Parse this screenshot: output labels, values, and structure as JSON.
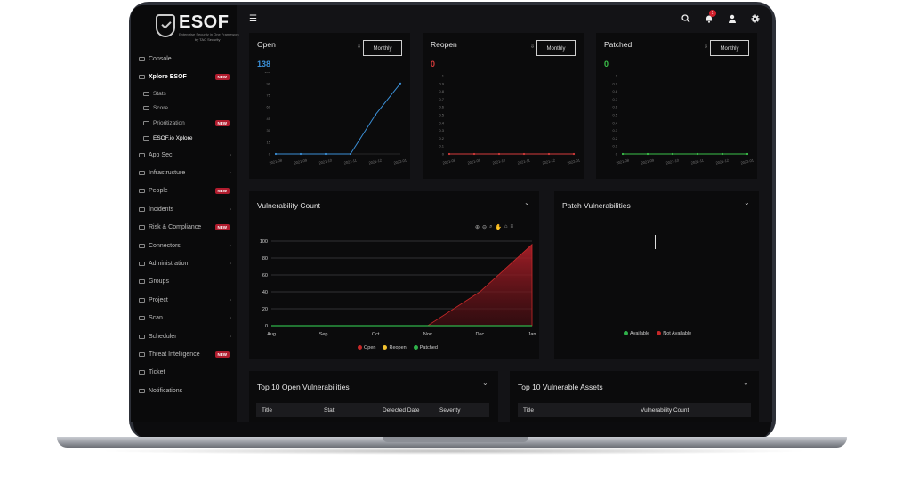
{
  "app": {
    "brand": "ESOF",
    "subtitle": "Enterprise Security in One Framework",
    "by": "by TAC Security",
    "notification_count": "1"
  },
  "icons": {
    "menu": "hamburger-icon",
    "search": "search-icon",
    "notifications": "bell-icon",
    "user": "user-icon",
    "settings": "gear-icon"
  },
  "sidebar": {
    "items": [
      {
        "label": "Console",
        "icon": "console-icon",
        "sub": false,
        "active": false,
        "chevron": false,
        "new": false
      },
      {
        "label": "Xplore ESOF",
        "icon": "explore-icon",
        "sub": false,
        "active": true,
        "chevron": false,
        "new": true
      },
      {
        "label": "Stats",
        "icon": "stats-icon",
        "sub": true,
        "active": false,
        "chevron": false,
        "new": false
      },
      {
        "label": "Score",
        "icon": "score-icon",
        "sub": true,
        "active": false,
        "chevron": false,
        "new": false
      },
      {
        "label": "Prioritization",
        "icon": "prioritization-icon",
        "sub": true,
        "active": false,
        "chevron": false,
        "new": true
      },
      {
        "label": "ESOF.io Xplore",
        "icon": "xplore-icon",
        "sub": true,
        "active": true,
        "chevron": false,
        "new": false
      },
      {
        "label": "App Sec",
        "icon": "appsec-icon",
        "sub": false,
        "active": false,
        "chevron": true,
        "new": false
      },
      {
        "label": "Infrastructure",
        "icon": "infrastructure-icon",
        "sub": false,
        "active": false,
        "chevron": true,
        "new": false
      },
      {
        "label": "People",
        "icon": "people-icon",
        "sub": false,
        "active": false,
        "chevron": false,
        "new": true
      },
      {
        "label": "Incidents",
        "icon": "incidents-icon",
        "sub": false,
        "active": false,
        "chevron": true,
        "new": false
      },
      {
        "label": "Risk & Compliance",
        "icon": "risk-icon",
        "sub": false,
        "active": false,
        "chevron": false,
        "new": true
      },
      {
        "label": "Connectors",
        "icon": "connectors-icon",
        "sub": false,
        "active": false,
        "chevron": true,
        "new": false
      },
      {
        "label": "Administration",
        "icon": "administration-icon",
        "sub": false,
        "active": false,
        "chevron": true,
        "new": false
      },
      {
        "label": "Groups",
        "icon": "groups-icon",
        "sub": false,
        "active": false,
        "chevron": false,
        "new": false
      },
      {
        "label": "Project",
        "icon": "project-icon",
        "sub": false,
        "active": false,
        "chevron": true,
        "new": false
      },
      {
        "label": "Scan",
        "icon": "scan-icon",
        "sub": false,
        "active": false,
        "chevron": true,
        "new": false
      },
      {
        "label": "Scheduler",
        "icon": "scheduler-icon",
        "sub": false,
        "active": false,
        "chevron": true,
        "new": false
      },
      {
        "label": "Threat Intelligence",
        "icon": "threat-icon",
        "sub": false,
        "active": false,
        "chevron": false,
        "new": true
      },
      {
        "label": "Ticket",
        "icon": "ticket-icon",
        "sub": false,
        "active": false,
        "chevron": false,
        "new": false
      },
      {
        "label": "Notifications",
        "icon": "notifications-icon",
        "sub": false,
        "active": false,
        "chevron": false,
        "new": false
      }
    ],
    "new_badge": "NEW"
  },
  "cards": {
    "open": {
      "title": "Open",
      "value": "138",
      "color": "#3b8fd6",
      "button": "Monthly"
    },
    "reopen": {
      "title": "Reopen",
      "value": "0",
      "color": "#d63b3b",
      "button": "Monthly"
    },
    "patched": {
      "title": "Patched",
      "value": "0",
      "color": "#3bc24a",
      "button": "Monthly"
    },
    "vuln_count": {
      "title": "Vulnerability Count"
    },
    "patch_vuln": {
      "title": "Patch Vulnerabilities",
      "legend": [
        "Available",
        "Not Available"
      ],
      "legend_colors": [
        "#2fb24a",
        "#c62828"
      ]
    },
    "top_open": {
      "title": "Top 10 Open Vulnerabilities",
      "columns": [
        "Title",
        "Stat",
        "Detected Date",
        "Severity"
      ]
    },
    "top_assets": {
      "title": "Top 10 Vulnerable Assets",
      "columns": [
        "Title",
        "Vulnerability Count"
      ]
    }
  },
  "chart_data": [
    {
      "type": "line",
      "id": "open",
      "title": "Open",
      "x": [
        "2021-08",
        "2021-09",
        "2021-10",
        "2021-11",
        "2021-12",
        "2022-01"
      ],
      "values": [
        0,
        0,
        0,
        0,
        50,
        90
      ],
      "ylim": [
        0,
        100
      ],
      "yticks": [
        0,
        15,
        30,
        45,
        60,
        75,
        90,
        105
      ]
    },
    {
      "type": "line",
      "id": "reopen",
      "title": "Reopen",
      "x": [
        "2021-08",
        "2021-09",
        "2021-10",
        "2021-11",
        "2021-12",
        "2022-01"
      ],
      "values": [
        0,
        0,
        0,
        0,
        0,
        0
      ],
      "ylim": [
        0,
        1
      ],
      "yticks": [
        0,
        0.1,
        0.2,
        0.3,
        0.4,
        0.5,
        0.6,
        0.7,
        0.8,
        0.9,
        1.0
      ]
    },
    {
      "type": "line",
      "id": "patched",
      "title": "Patched",
      "x": [
        "2021-08",
        "2021-09",
        "2021-10",
        "2021-11",
        "2021-12",
        "2022-01"
      ],
      "values": [
        0,
        0,
        0,
        0,
        0,
        0
      ],
      "ylim": [
        0,
        1
      ],
      "yticks": [
        0,
        0.1,
        0.2,
        0.3,
        0.4,
        0.5,
        0.6,
        0.7,
        0.8,
        0.9,
        1.0
      ]
    },
    {
      "type": "area",
      "id": "vuln_count",
      "title": "Vulnerability Count",
      "x": [
        "Aug",
        "Sep",
        "Oct",
        "Nov",
        "Dec",
        "Jan"
      ],
      "ylim": [
        0,
        100
      ],
      "yticks": [
        0,
        20,
        40,
        60,
        80,
        100
      ],
      "series": [
        {
          "name": "Open",
          "color": "#c62828",
          "values": [
            0,
            0,
            0,
            0,
            40,
            96
          ]
        },
        {
          "name": "Reopen",
          "color": "#f2c230",
          "values": [
            0,
            0,
            0,
            0,
            0,
            0
          ]
        },
        {
          "name": "Patched",
          "color": "#2fb24a",
          "values": [
            0,
            0,
            0,
            0,
            0,
            0
          ]
        }
      ],
      "grid": true,
      "legend_position": "bottom"
    }
  ]
}
